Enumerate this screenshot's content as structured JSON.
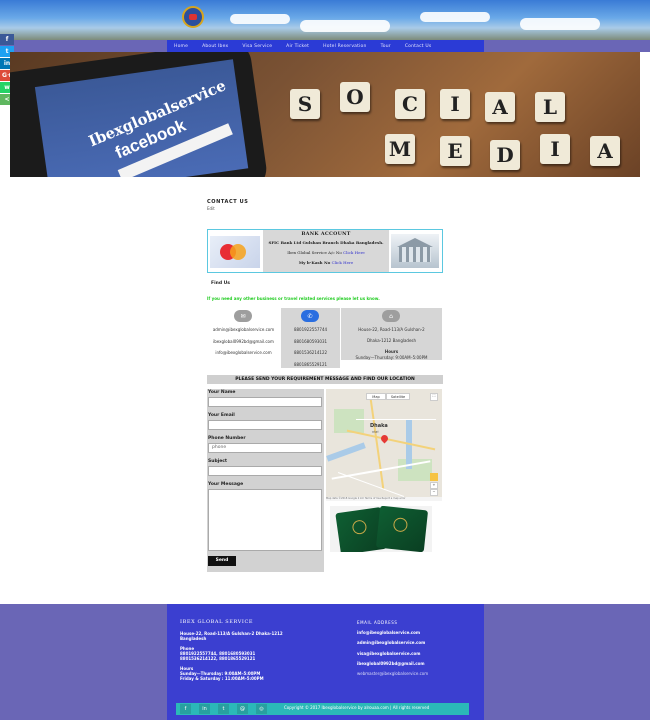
{
  "nav": {
    "items": [
      "Home",
      "About Ibex",
      "Visa Service",
      "Air Ticket",
      "Hotel Reservation",
      "Tour",
      "Contact Us"
    ]
  },
  "social_bar": [
    {
      "icon": "facebook-icon",
      "glyph": "f",
      "color": "#3b5998"
    },
    {
      "icon": "twitter-icon",
      "glyph": "t",
      "color": "#1da1f2"
    },
    {
      "icon": "linkedin-icon",
      "glyph": "in",
      "color": "#0077b5"
    },
    {
      "icon": "google-plus-icon",
      "glyph": "G+",
      "color": "#dd4b39"
    },
    {
      "icon": "whatsapp-icon",
      "glyph": "w",
      "color": "#25d366"
    },
    {
      "icon": "share-icon",
      "glyph": "<",
      "color": "#5fb760"
    }
  ],
  "hero": {
    "phone_line1": "Ibexglobalservice",
    "phone_line2": "facebook",
    "tiles_word1": [
      "S",
      "O",
      "C",
      "I",
      "A",
      "L"
    ],
    "tiles_word2": [
      "M",
      "E",
      "D",
      "I",
      "A"
    ]
  },
  "contact": {
    "title": "CONTACT US",
    "edit": "Edit"
  },
  "bank": {
    "title": "BANK ACCOUNT",
    "branch": "SFIC Bank Ltd Gulshan Branch Dhaka Bangladesh.",
    "account_label": "Ibex Global Service A/c No",
    "account_link": "Click Here",
    "bkash_label": "My b-Kash No",
    "bkash_link": "Click Here"
  },
  "find_us": {
    "title": "Find Us",
    "note": "If you need any other business or travel related services please let us know."
  },
  "contact_columns": {
    "emails": [
      "admin@ibexglobalservice.com",
      "ibexglobal0992bd@gmail.com",
      "info@ibexglobalservice.com"
    ],
    "phones": [
      "8801922557744",
      "8801680593031",
      "8801536214122",
      "8801865529121"
    ],
    "address": [
      "House-22, Road-113/A Gulshan-2",
      "Dhaka-1212 Bangladesh"
    ],
    "hours_title": "Hours",
    "hours": "Sunday—Thursday: 9:00AM–5:00PM",
    "colors": {
      "mail": "#9e9e9e",
      "phone": "#2a6ee0",
      "home": "#9e9e9e"
    }
  },
  "form": {
    "heading": "PLEASE SEND YOUR REQUIREMENT MESSAGE AND FIND OUR LOCATION",
    "name_label": "Your Name",
    "email_label": "Your Email",
    "phone_label": "Phone Number",
    "phone_placeholder": "phone",
    "subject_label": "Subject",
    "message_label": "Your Message",
    "send": "Send"
  },
  "map": {
    "btn_map": "Map",
    "btn_sat": "Satellite",
    "city": "Dhaka",
    "city_local": "ঢাকা",
    "footer": "Map data ©2018 Google   2 km   Terms of Use   Report a map error"
  },
  "footer": {
    "title": "IBEX GLOBAL SERVICE",
    "address": "House-22, Road-113/A Gulshan-2 Dhaka-1212 Bangladesh",
    "phone_label": "Phone",
    "phones_line1": "8801922557744, 8801680593031",
    "phones_line2": "8801536214122, 8801865529121",
    "hours_label": "Hours",
    "hours_line1": "Sunday—Thursday: 9:00AM–5:00PM",
    "hours_line2": "Friday & Saturday : 11:00AM–5:00PM",
    "email_title": "EMAIL ADDRESS",
    "emails": [
      "info@ibexglobalservice.com",
      "admin@ibexglobalservice.com",
      "visa@ibexglobalservice.com",
      "ibexglobal0992bd@gmail.com",
      "webmaster@ibexglobalservice.com"
    ],
    "social": [
      "f",
      "in",
      "t",
      "@",
      "◎"
    ],
    "copyright": "Copyright © 2017 Ibexglobalservice by alrouaa.com | All rights reserved"
  }
}
